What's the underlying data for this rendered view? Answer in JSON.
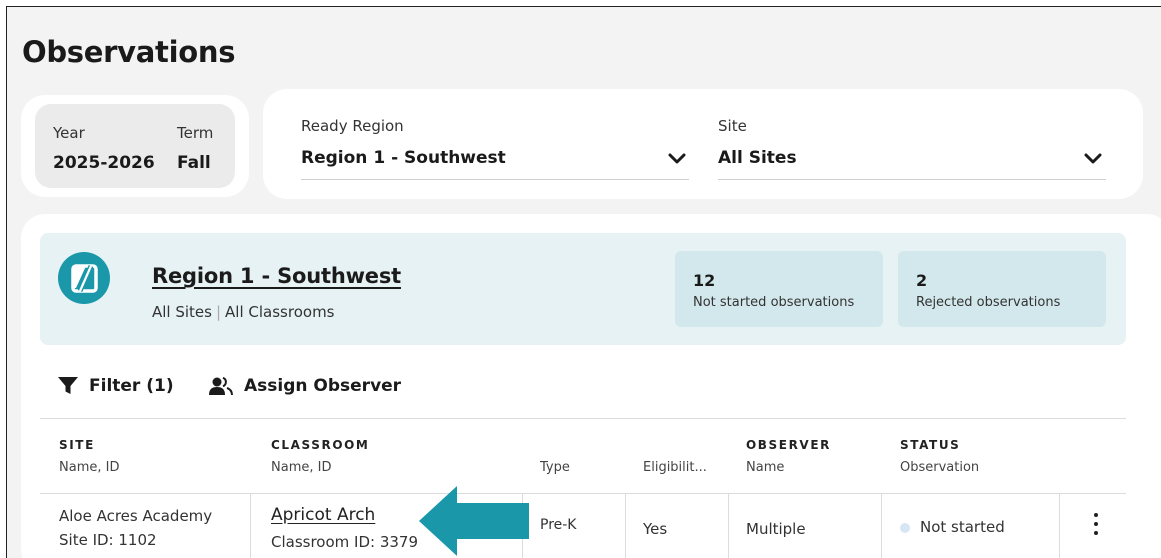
{
  "page": {
    "title": "Observations"
  },
  "period": {
    "year_label": "Year",
    "year_value": "2025-2026",
    "term_label": "Term",
    "term_value": "Fall"
  },
  "filters": {
    "region_label": "Ready Region",
    "region_value": "Region 1 - Southwest",
    "site_label": "Site",
    "site_value": "All Sites"
  },
  "summary": {
    "region_name": "Region 1 - Southwest",
    "scope_sites": "All Sites",
    "scope_classrooms": "All Classrooms",
    "stats": [
      {
        "count": "12",
        "label": "Not started observations"
      },
      {
        "count": "2",
        "label": "Rejected observations"
      }
    ]
  },
  "toolbar": {
    "filter_label": "Filter (1)",
    "assign_label": "Assign Observer"
  },
  "table": {
    "columns": [
      {
        "title": "SITE",
        "sub": "Name, ID"
      },
      {
        "title": "CLASSROOM",
        "sub": "Name, ID"
      },
      {
        "title": "",
        "sub": "Type"
      },
      {
        "title": "",
        "sub": "Eligibilit..."
      },
      {
        "title": "OBSERVER",
        "sub": "Name"
      },
      {
        "title": "STATUS",
        "sub": "Observation"
      }
    ],
    "rows": [
      {
        "site_name": "Aloe Acres Academy",
        "site_id": "Site ID: 1102",
        "classroom_name": "Apricot Arch",
        "classroom_id": "Classroom ID: 3379",
        "type": "Pre-K",
        "eligibility": "Yes",
        "observer": "Multiple",
        "status": "Not started"
      }
    ]
  },
  "colors": {
    "accent": "#1a98a9",
    "region_bg": "#e7f2f4",
    "stat_bg": "#d3e8ec",
    "status_dot": "#d7e6f5"
  },
  "icons": {
    "region_chevron": "chevron-down-icon",
    "site_chevron": "chevron-down-icon",
    "filter": "funnel-icon",
    "assign": "user-group-icon",
    "logo": "region-logo-icon",
    "row_menu": "kebab-menu-icon",
    "callout": "arrow-left-icon"
  }
}
